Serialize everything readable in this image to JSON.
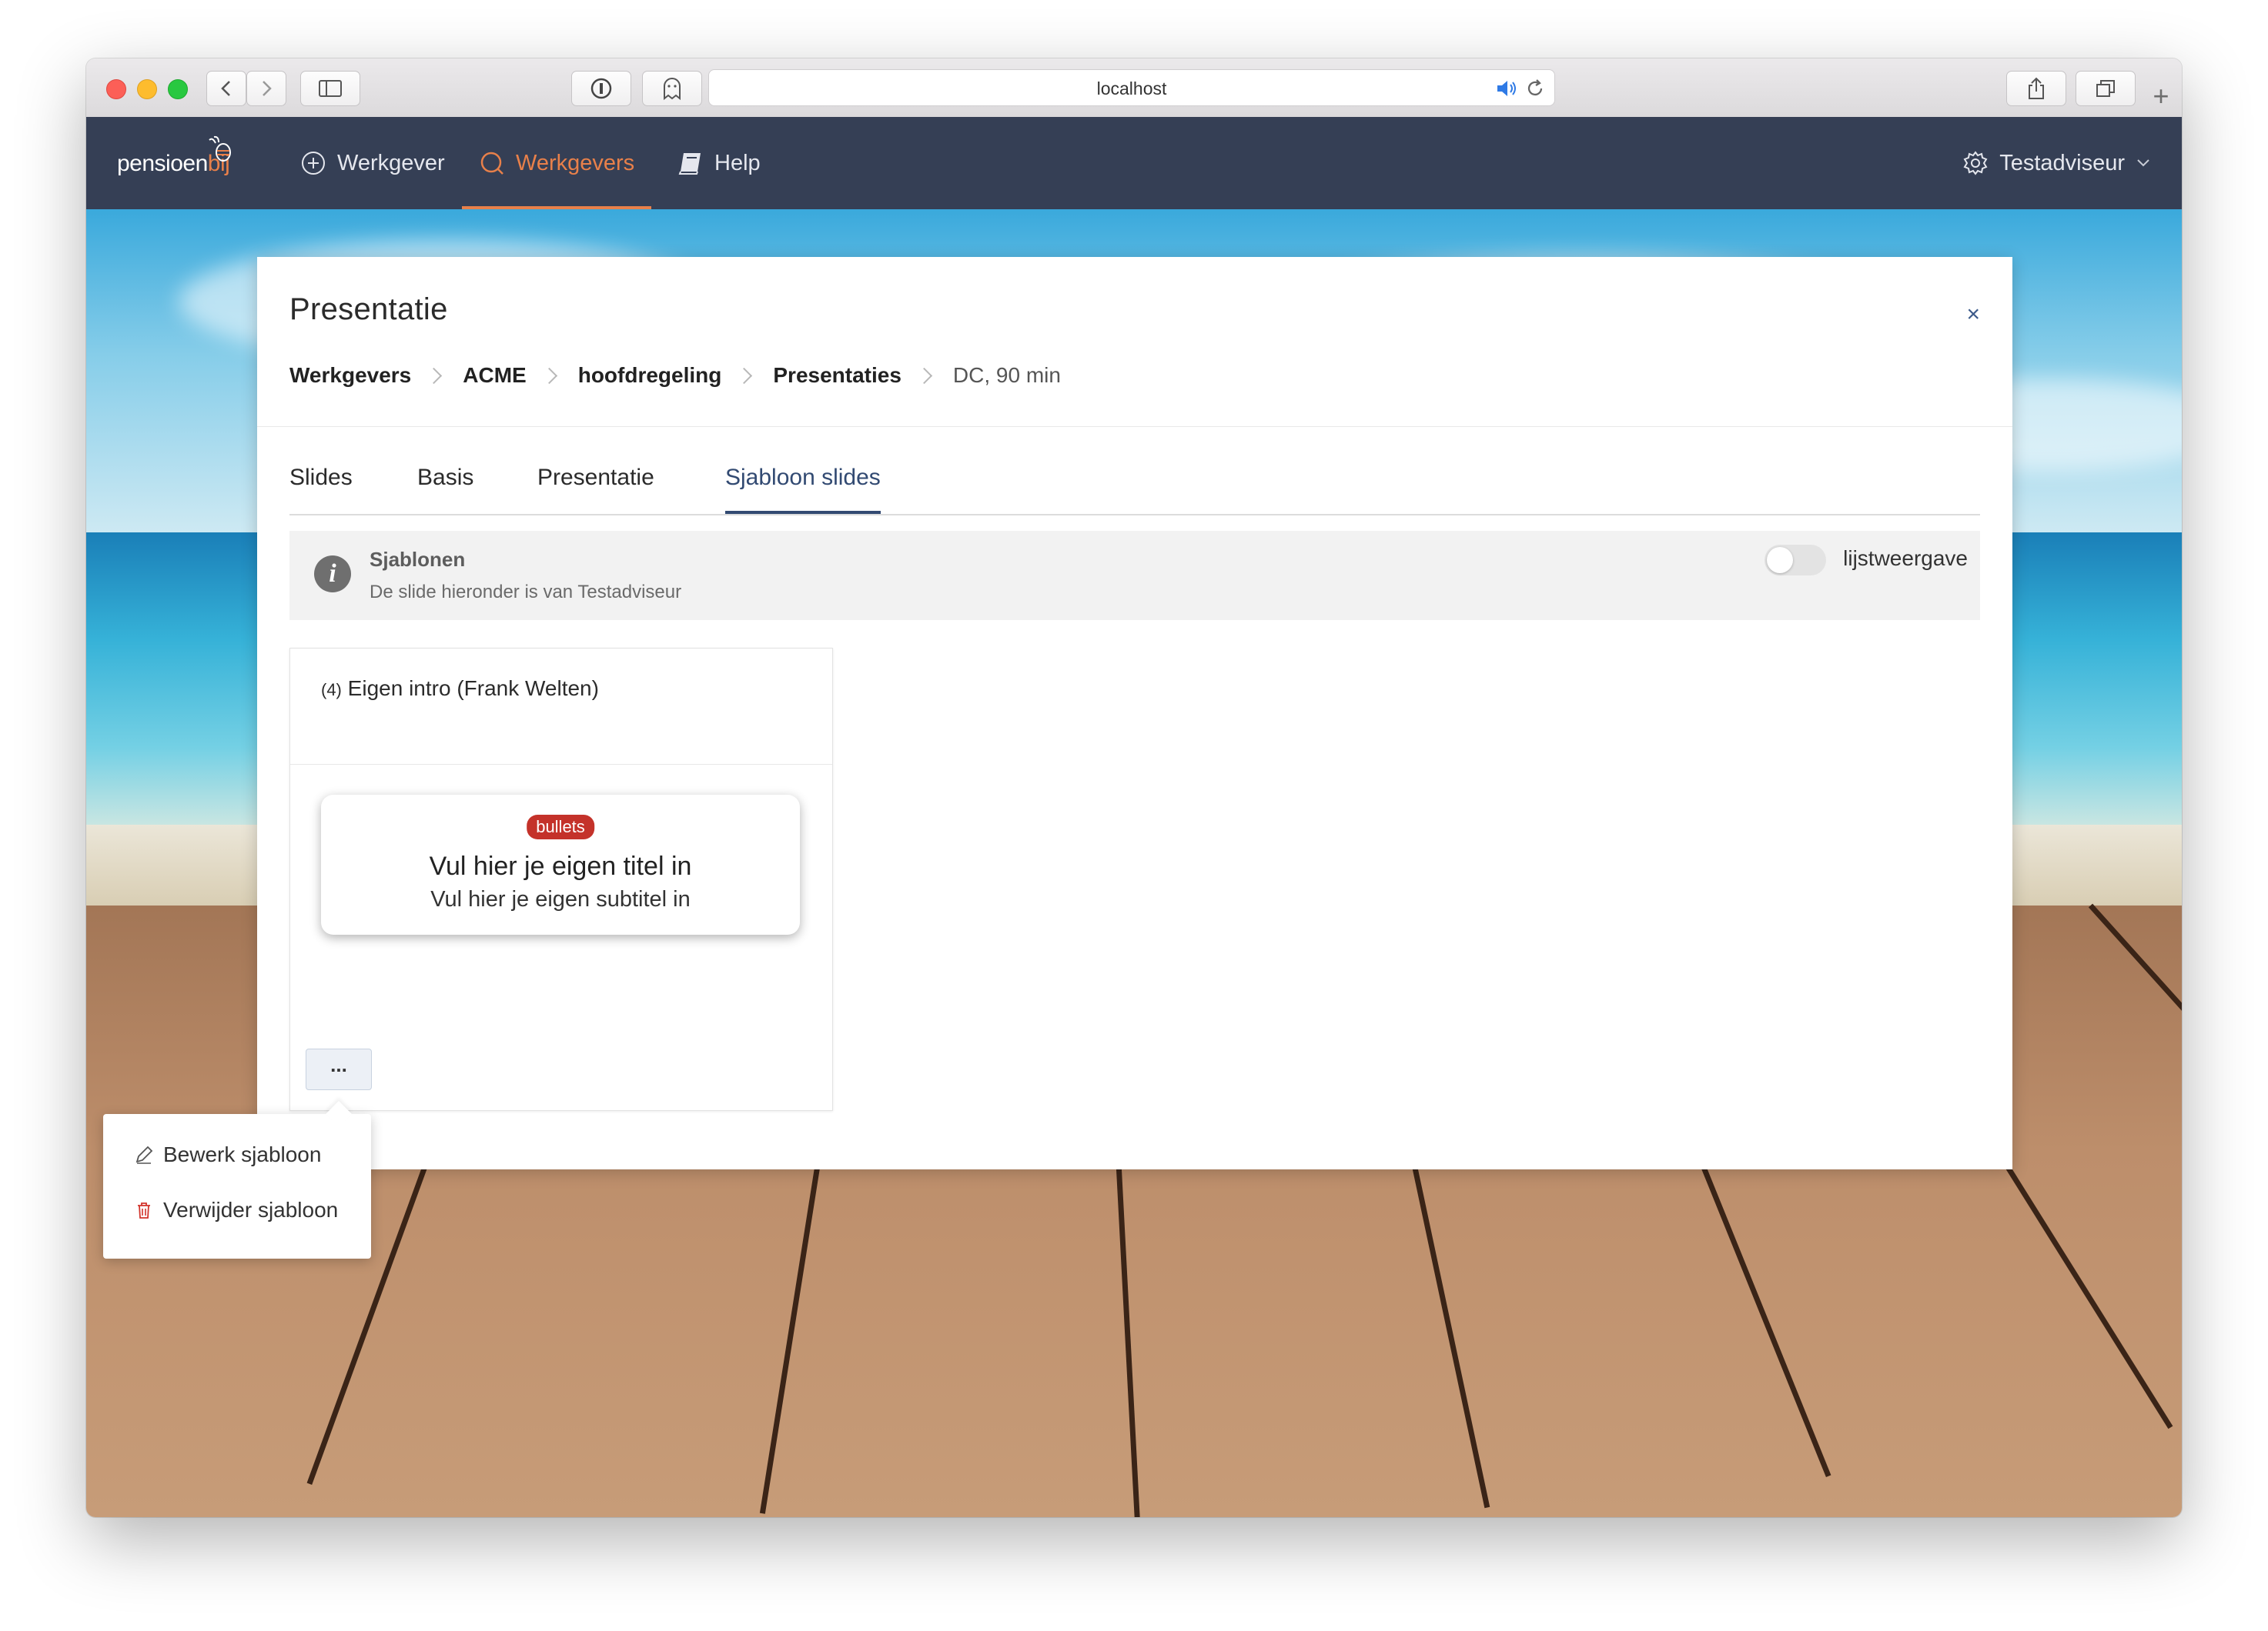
{
  "browser": {
    "url": "localhost"
  },
  "navbar": {
    "logo_main": "pensioen",
    "logo_accent": "bij",
    "items": [
      {
        "label": "Werkgever"
      },
      {
        "label": "Werkgevers"
      },
      {
        "label": "Help"
      }
    ],
    "user": "Testadviseur"
  },
  "colors": {
    "navbar_bg": "#353f55",
    "accent_orange": "#e8804a",
    "tab_active": "#324a72",
    "badge_red": "#c4322a"
  },
  "modal": {
    "title": "Presentatie",
    "close": "×",
    "breadcrumb": [
      "Werkgevers",
      "ACME",
      "hoofdregeling",
      "Presentaties",
      "DC, 90 min"
    ],
    "tabs": [
      "Slides",
      "Basis",
      "Presentatie",
      "Sjabloon slides"
    ],
    "active_tab": "Sjabloon slides",
    "info": {
      "title": "Sjablonen",
      "text": "De slide hieronder is van Testadviseur",
      "toggle_label": "lijstweergave"
    },
    "card": {
      "number": "(4)",
      "title": "Eigen intro (Frank Welten)",
      "badge": "bullets",
      "slide_title": "Vul hier je eigen titel in",
      "slide_subtitle": "Vul hier je eigen subtitel in",
      "more_label": "..."
    }
  },
  "menu": {
    "items": [
      {
        "label": "Bewerk sjabloon",
        "icon": "pencil-icon"
      },
      {
        "label": "Verwijder sjabloon",
        "icon": "trash-icon"
      }
    ]
  }
}
